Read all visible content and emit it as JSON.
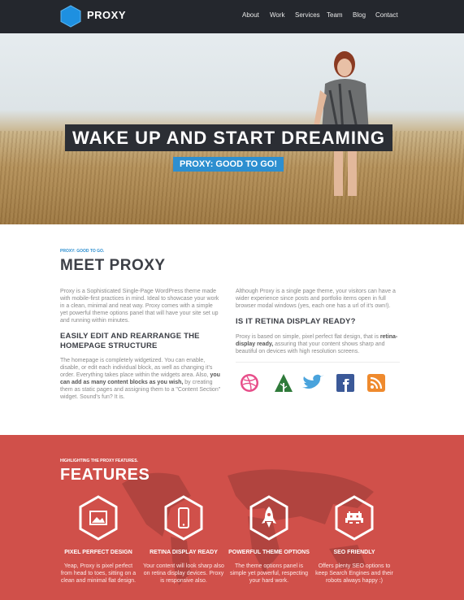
{
  "nav": {
    "brand": "PROXY",
    "items": [
      "About",
      "Work",
      "Services",
      "Team",
      "Blog",
      "Contact"
    ]
  },
  "hero": {
    "title": "WAKE UP AND START DREAMING",
    "subtitle": "PROXY: GOOD TO GO!",
    "slides": 3,
    "active_slide": 1
  },
  "meet": {
    "kicker": "PROXY: GOOD TO GO.",
    "title": "MEET PROXY",
    "intro": "Proxy is a Sophisticated Single-Page WordPress theme made with mobile-first practices in mind. Ideal to showcase your work in a clean, minimal and neat way. Proxy comes with a simple yet powerful theme options panel that will have your site set up and running within minutes.",
    "edit_heading": "EASILY EDIT AND REARRANGE THE HOMEPAGE STRUCTURE",
    "edit_text_1": "The homepage is completely widgetized. You can enable, disable, or edit each individual block, as well as changing it's order. Everything takes place within the widgets area. Also, ",
    "edit_text_bold": "you can add as many content blocks as you wish,",
    "edit_text_2": " by creating them as static pages and assigning them to a \"Content Section\" widget. Sound's fun? It is.",
    "right_intro": "Although Proxy is a single page theme, your visitors can have a wider experience since posts and portfolio items open in full browser modal windows (yes, each one has a url of it's own!).",
    "retina_heading": "IS IT RETINA DISPLAY READY?",
    "retina_text_1": "Proxy is based on simple, pixel perfect flat design, that is ",
    "retina_text_bold": "retina-display ready,",
    "retina_text_2": " assuring that your content shows sharp and beautiful on devices with high resolution screens."
  },
  "social": [
    "dribbble-icon",
    "forrst-icon",
    "twitter-icon",
    "facebook-icon",
    "rss-icon"
  ],
  "features": {
    "kicker": "HIGHLIGHTING THE PROXY FEATURES.",
    "title": "FEATURES",
    "items": [
      {
        "name": "PIXEL PERFECT DESIGN",
        "text": "Yeap, Proxy is pixel perfect from head to toes, sitting on a clean and minimal flat design.",
        "icon": "image-icon"
      },
      {
        "name": "RETINA DISPLAY READY",
        "text": "Your content will look sharp also on retina display devices. Proxy is responsive also.",
        "icon": "phone-icon"
      },
      {
        "name": "POWERFUL THEME OPTIONS",
        "text": "The theme options panel is simple yet powerful, respecting your hard work.",
        "icon": "rocket-icon"
      },
      {
        "name": "SEO FRIENDLY",
        "text": "Offers plenty SEO options to keep Search Engines and their robots always happy :)",
        "icon": "invader-icon"
      }
    ]
  },
  "colors": {
    "nav_bg": "#24272d",
    "accent_blue": "#2d8fd0",
    "features_red": "#d0504a",
    "heading_dark": "#3c3f46"
  }
}
